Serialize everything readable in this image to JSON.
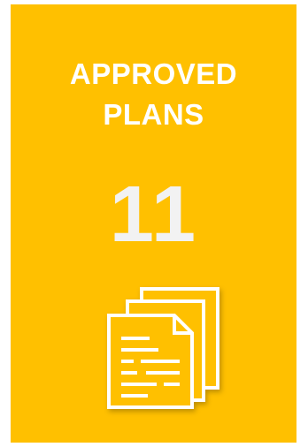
{
  "card": {
    "title_line1": "APPROVED",
    "title_line2": "PLANS",
    "count": "11",
    "background_color": "#FFC000",
    "text_color": "#FFFFFF",
    "icon": "documents-stack-icon"
  }
}
